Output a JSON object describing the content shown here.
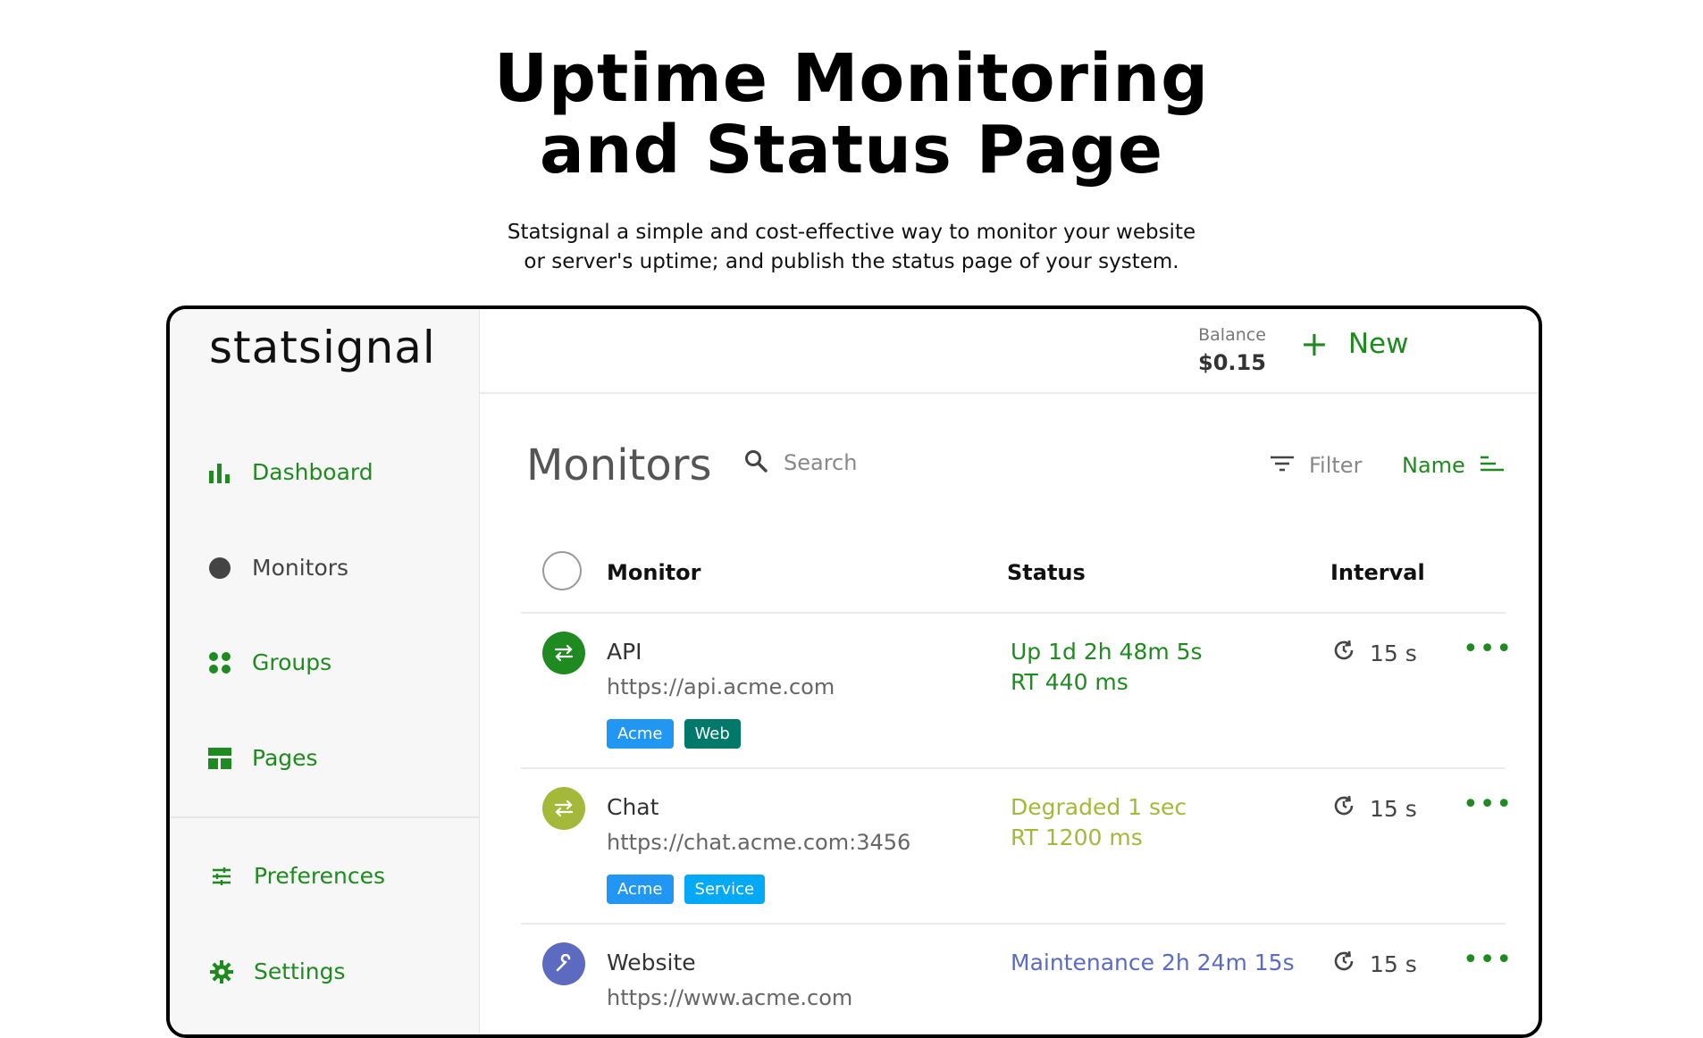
{
  "hero": {
    "title_line1": "Uptime Monitoring",
    "title_line2": "and Status Page",
    "subtitle_line1": "Statsignal a simple and cost-effective way to monitor your website",
    "subtitle_line2": "or server's uptime; and publish the status page of your system."
  },
  "app": {
    "logo": "statsignal",
    "sidebar": {
      "items": [
        {
          "label": "Dashboard",
          "icon": "bar-chart-icon"
        },
        {
          "label": "Monitors",
          "icon": "dot-icon"
        },
        {
          "label": "Groups",
          "icon": "grid-dots-icon"
        },
        {
          "label": "Pages",
          "icon": "layout-icon"
        },
        {
          "label": "Preferences",
          "icon": "sliders-icon"
        },
        {
          "label": "Settings",
          "icon": "gear-icon"
        }
      ]
    },
    "topbar": {
      "balance_label": "Balance",
      "balance_value": "$0.15",
      "new_label": "New"
    },
    "main": {
      "title": "Monitors",
      "search_placeholder": "Search",
      "filter_label": "Filter",
      "sort_label": "Name"
    },
    "table": {
      "headers": {
        "monitor": "Monitor",
        "status": "Status",
        "interval": "Interval"
      },
      "rows": [
        {
          "name": "API",
          "url": "https://api.acme.com",
          "tags": [
            {
              "label": "Acme",
              "color": "#2196f3"
            },
            {
              "label": "Web",
              "color": "#00796b"
            }
          ],
          "status_line1": "Up 1d 2h 48m 5s",
          "status_line2": "RT 440 ms",
          "status_color": "#1f8a1f",
          "icon_color": "#1f8a1f",
          "interval": "15 s"
        },
        {
          "name": "Chat",
          "url": "https://chat.acme.com:3456",
          "tags": [
            {
              "label": "Acme",
              "color": "#2196f3"
            },
            {
              "label": "Service",
              "color": "#03a9f4"
            }
          ],
          "status_line1": "Degraded 1 sec",
          "status_line2": "RT 1200 ms",
          "status_color": "#a4b83a",
          "icon_color": "#a4b83a",
          "interval": "15 s"
        },
        {
          "name": "Website",
          "url": "https://www.acme.com",
          "tags": [],
          "status_line1": "Maintenance 2h 24m 15s",
          "status_line2": "",
          "status_color": "#5c6bc0",
          "icon_color": "#5c6bc0",
          "interval": "15 s"
        }
      ]
    }
  }
}
